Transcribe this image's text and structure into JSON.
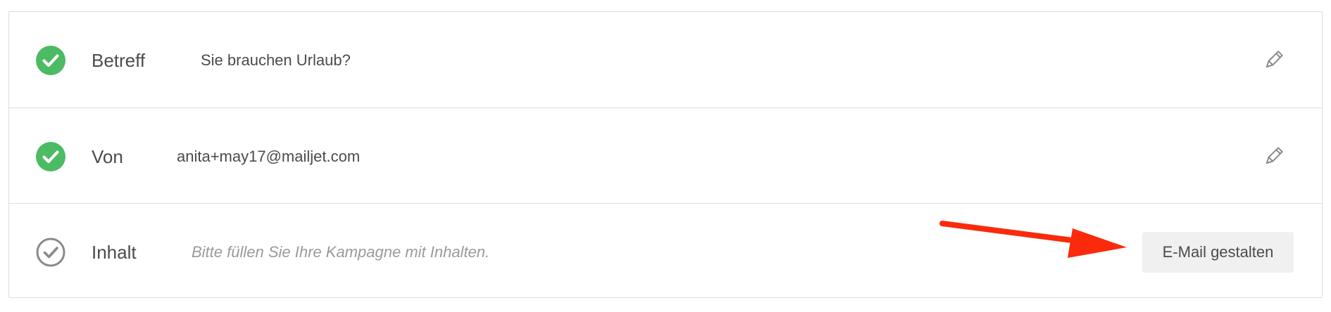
{
  "rows": [
    {
      "title": "Betreff",
      "value": "Sie brauchen Urlaub?",
      "status": "complete",
      "status_icon": "check-circle-filled-icon",
      "action_icon": "pencil-icon"
    },
    {
      "title": "Von",
      "value": "anita+may17@mailjet.com",
      "status": "complete",
      "status_icon": "check-circle-filled-icon",
      "action_icon": "pencil-icon"
    },
    {
      "title": "Inhalt",
      "value": "Bitte füllen Sie Ihre Kampagne mit Inhalten.",
      "status": "incomplete",
      "status_icon": "check-circle-outline-icon",
      "action_label": "E-Mail gestalten"
    }
  ],
  "colors": {
    "complete_green": "#4cbb63",
    "incomplete_gray": "#8a8a8a",
    "annotation_arrow": "#fb2a0c",
    "border": "#dcdcdc"
  },
  "annotation": {
    "type": "arrow",
    "points_to": "E-Mail gestalten"
  }
}
